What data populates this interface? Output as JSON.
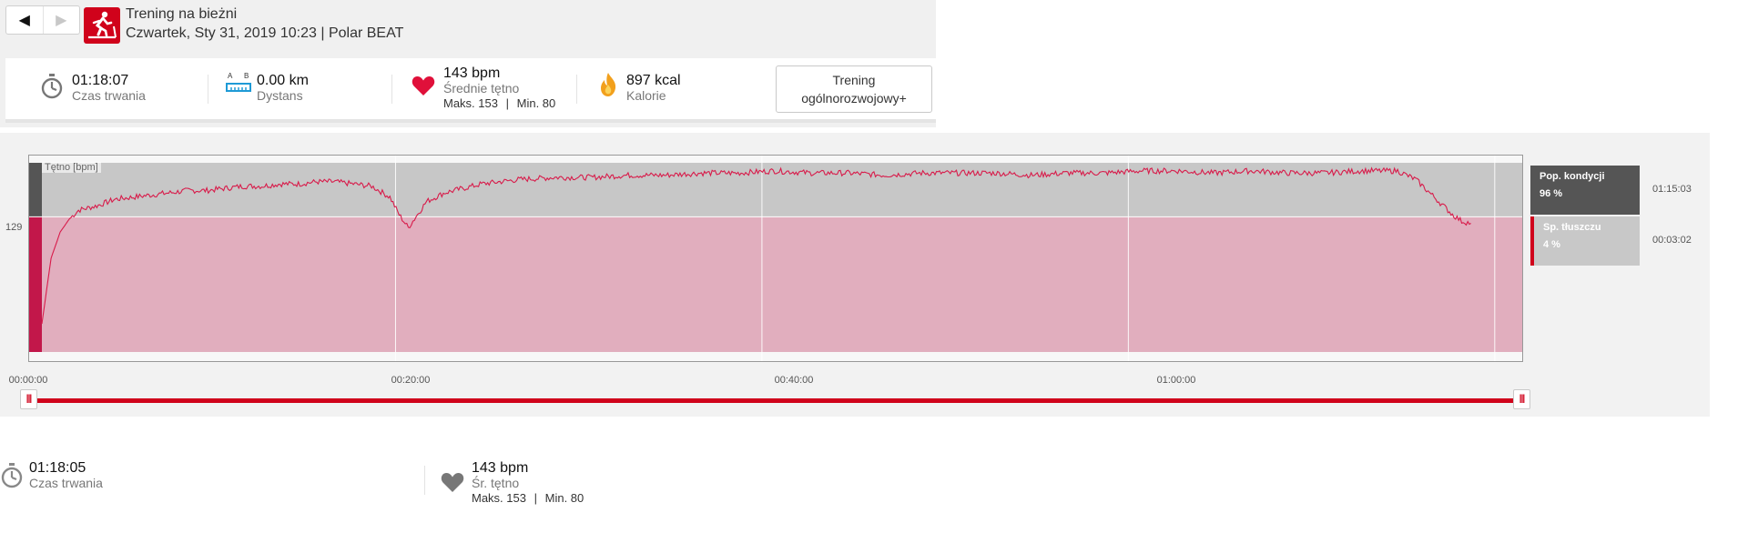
{
  "header": {
    "nav": {
      "back_icon": "◀",
      "forward_icon": "▶"
    },
    "sport_icon": "treadmill-icon",
    "title": "Trening na bieżni",
    "subtitle": "Czwartek, Sty 31, 2019 10:23 | Polar BEAT"
  },
  "stats": {
    "duration": {
      "value": "01:18:07",
      "label": "Czas trwania"
    },
    "distance": {
      "marker_a": "A",
      "marker_b": "B",
      "value": "0.00 km",
      "label": "Dystans"
    },
    "heart_rate": {
      "value": "143 bpm",
      "label": "Średnie tętno",
      "max": "Maks. 153",
      "divider": "|",
      "min": "Min. 80"
    },
    "calories": {
      "value": "897 kcal",
      "label": "Kalorie"
    },
    "training_button": {
      "line1": "Trening",
      "line2": "ogólnorozwojowy+"
    }
  },
  "chart_data": {
    "type": "area",
    "title": "Tętno [bpm]",
    "xlabel": "",
    "ylabel": "",
    "x_ticks": [
      "00:00:00",
      "00:20:00",
      "00:40:00",
      "01:00:00"
    ],
    "y_ticks": [
      "129"
    ],
    "x_range_minutes": [
      0,
      78.1
    ],
    "y_range_bpm": [
      80,
      153
    ],
    "zone_threshold_bpm": 129,
    "series": [
      {
        "values_x_minutes": [
          0,
          0.5,
          1,
          1.5,
          2,
          3,
          4,
          5,
          6,
          7,
          8,
          9,
          10,
          11,
          12,
          13,
          14,
          15,
          16,
          17,
          18,
          19,
          19.5,
          20,
          20.5,
          21,
          22,
          23,
          24,
          25,
          26,
          28,
          30,
          32,
          34,
          36,
          38,
          40,
          42,
          44,
          46,
          48,
          50,
          52,
          54,
          56,
          58,
          60,
          62,
          64,
          66,
          68,
          70,
          72,
          74,
          75,
          76,
          77,
          77.5,
          78
        ],
        "values_bpm": [
          80,
          110,
          122,
          128,
          132,
          134,
          137,
          138,
          139,
          140,
          141,
          141,
          142,
          143,
          143,
          144,
          144,
          145,
          145,
          144,
          143,
          138,
          130,
          124,
          130,
          136,
          140,
          142,
          144,
          145,
          146,
          147,
          147,
          148,
          148,
          149,
          149,
          150,
          149,
          149,
          148,
          149,
          149,
          149,
          148,
          149,
          149,
          150,
          150,
          149,
          150,
          149,
          149,
          150,
          150,
          146,
          138,
          130,
          127,
          126
        ]
      }
    ],
    "colors": {
      "upper_zone": "#c7c7c7",
      "lower_zone": "#e1aebe",
      "line": "#d81b4a"
    }
  },
  "zones": [
    {
      "name": "Pop. kondycji",
      "percent": "96 %",
      "duration": "01:15:03",
      "color": "#555555"
    },
    {
      "name": "Sp. tłuszczu",
      "percent": "4 %",
      "duration": "00:03:02",
      "color": "#c8c8c8"
    }
  ],
  "slider": {
    "handle_glyph": "|||"
  },
  "summary": {
    "duration": {
      "value": "01:18:05",
      "label": "Czas trwania"
    },
    "heart_rate": {
      "value": "143 bpm",
      "label": "Śr. tętno",
      "max": "Maks. 153",
      "divider": "|",
      "min": "Min. 80"
    }
  }
}
